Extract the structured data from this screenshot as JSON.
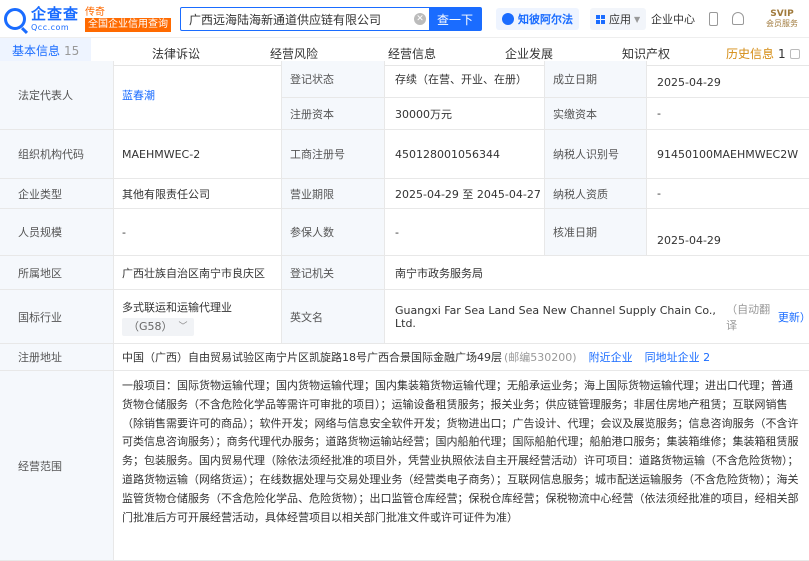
{
  "header": {
    "logo_cn": "企查查",
    "logo_en": "Qcc.com",
    "tag_top": "传奇",
    "tag_sub": "全国企业信用查询",
    "search_value": "广西远海陆海新通道供应链有限公司",
    "search_button": "查一下",
    "zhibi_label": "知彼阿尔法",
    "app_label": "应用",
    "center_label": "企业中心",
    "vip_top": "SVIP",
    "vip_sub": "会员服务"
  },
  "tabs": [
    {
      "label": "基本信息",
      "count": "15"
    },
    {
      "label": "法律诉讼"
    },
    {
      "label": "经营风险"
    },
    {
      "label": "经营信息"
    },
    {
      "label": "企业发展"
    },
    {
      "label": "知识产权"
    },
    {
      "label": "历史信息",
      "count": "1"
    }
  ],
  "rows": {
    "legal_rep_label": "法定代表人",
    "legal_rep_value": "蓝春潮",
    "reg_status_label": "登记状态",
    "reg_status_value": "存续（在营、开业、在册）",
    "found_date_label": "成立日期",
    "found_date_value": "2025-04-29",
    "reg_capital_label": "注册资本",
    "reg_capital_value": "30000万元",
    "paid_capital_label": "实缴资本",
    "paid_capital_value": "-",
    "org_code_label": "组织机构代码",
    "org_code_value": "MAEHMWEC-2",
    "biz_reg_label": "工商注册号",
    "biz_reg_value": "450128001056344",
    "taxpayer_id_label": "纳税人识别号",
    "taxpayer_id_value": "91450100MAEHMWEC2W",
    "company_type_label": "企业类型",
    "company_type_value": "其他有限责任公司",
    "biz_term_label": "营业期限",
    "biz_term_value": "2025-04-29 至 2045-04-27",
    "taxpayer_qual_label": "纳税人资质",
    "taxpayer_qual_value": "-",
    "staff_size_label": "人员规模",
    "staff_size_value": "-",
    "insured_label": "参保人数",
    "insured_value": "-",
    "approval_date_label": "核准日期",
    "approval_date_value": "2025-04-29",
    "region_label": "所属地区",
    "region_value": "广西壮族自治区南宁市良庆区",
    "authority_label": "登记机关",
    "authority_value": "南宁市政务服务局",
    "industry_label": "国标行业",
    "industry_value": "多式联运和运输代理业",
    "industry_code": "（G58）",
    "english_name_label": "英文名",
    "english_name_value": "Guangxi Far Sea Land Sea New Channel Supply Chain Co., Ltd.",
    "auto_translate": "（自动翻译",
    "update_link": "更新）",
    "address_label": "注册地址",
    "address_value": "中国（广西）自由贸易试验区南宁片区凯旋路18号广西合景国际金融广场49层",
    "postcode": "(邮编530200)",
    "nearby_link": "附近企业",
    "same_address_link": "同地址企业 2",
    "scope_label": "经营范围",
    "scope_value": "一般项目：国际货物运输代理；国内货物运输代理；国内集装箱货物运输代理；无船承运业务；海上国际货物运输代理；进出口代理；普通货物仓储服务（不含危险化学品等需许可审批的项目）；运输设备租赁服务；报关业务；供应链管理服务；非居住房地产租赁；互联网销售（除销售需要许可的商品）；软件开发；网络与信息安全软件开发；货物进出口；广告设计、代理；会议及展览服务；信息咨询服务（不含许可类信息咨询服务）；商务代理代办服务；道路货物运输站经营；国内船舶代理；国际船舶代理；船舶港口服务；集装箱维修；集装箱租赁服务；包装服务。国内贸易代理（除依法须经批准的项目外，凭营业执照依法自主开展经营活动）许可项目：道路货物运输（不含危险货物）；道路货物运输（网络货运）；在线数据处理与交易处理业务（经营类电子商务）；互联网信息服务；城市配送运输服务（不含危险货物）；海关监管货物仓储服务（不含危险化学品、危险货物）；出口监管仓库经营；保税仓库经营；保税物流中心经营（依法须经批准的项目，经相关部门批准后方可开展经营活动，具体经营项目以相关部门批准文件或许可证件为准）"
  },
  "colors": {
    "accent": "#1a6cff",
    "label_bg": "#f5f8fc",
    "orange": "#ff6a00"
  }
}
